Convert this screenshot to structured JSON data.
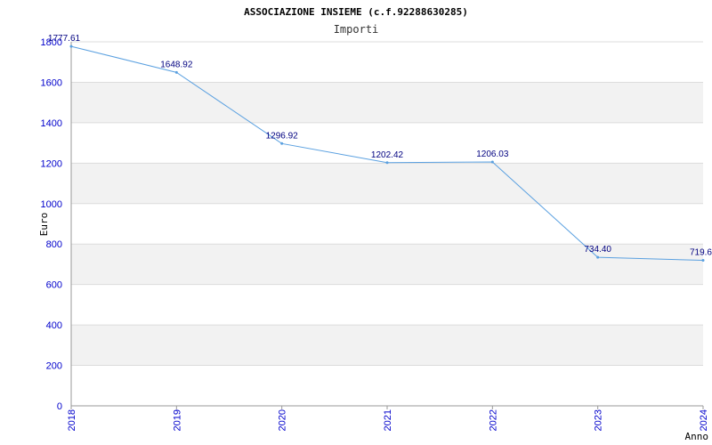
{
  "chart_data": {
    "type": "line",
    "title": "ASSOCIAZIONE INSIEME (c.f.92288630285)",
    "subtitle": "Importi",
    "ylabel": "Euro",
    "xlabel": "Anno",
    "categories": [
      "2018",
      "2019",
      "2020",
      "2021",
      "2022",
      "2023",
      "2024"
    ],
    "values": [
      1777.61,
      1648.92,
      1296.92,
      1202.42,
      1206.03,
      734.4,
      719.6
    ],
    "data_labels": [
      "1777.61",
      "1648.92",
      "1296.92",
      "1202.42",
      "1206.03",
      "734.40",
      "719.6"
    ],
    "ylim": [
      0,
      1800
    ],
    "yticks": [
      0,
      200,
      400,
      600,
      800,
      1000,
      1200,
      1400,
      1600,
      1800
    ],
    "grid": true,
    "colors": {
      "line": "#5aa0e0",
      "band": "#f2f2f2",
      "gridline": "#dcdcdc",
      "tick_text": "#0000cc",
      "data_label": "#000080"
    }
  }
}
